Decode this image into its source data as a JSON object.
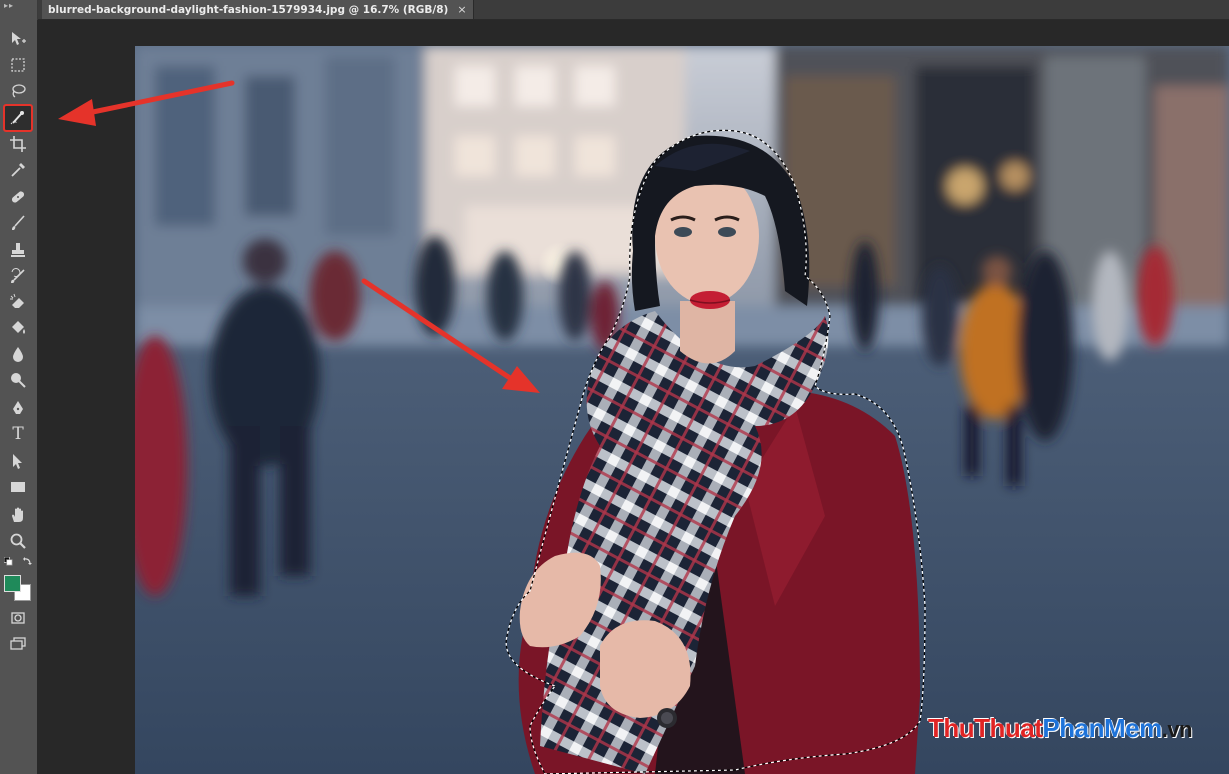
{
  "document_tab": {
    "title": "blurred-background-daylight-fashion-1579934.jpg @ 16.7% (RGB/8)",
    "close_glyph": "×"
  },
  "toolbar": {
    "grip": "▸▸",
    "tools": [
      {
        "name": "move-tool",
        "icon": "move-icon"
      },
      {
        "name": "marquee-tool",
        "icon": "marquee-icon"
      },
      {
        "name": "lasso-tool",
        "icon": "lasso-icon"
      },
      {
        "name": "quick-selection-tool",
        "icon": "quick-selection-icon",
        "active": true
      },
      {
        "name": "crop-tool",
        "icon": "crop-icon"
      },
      {
        "name": "eyedropper-tool",
        "icon": "eyedropper-icon"
      },
      {
        "name": "healing-brush-tool",
        "icon": "bandage-icon"
      },
      {
        "name": "brush-tool",
        "icon": "brush-icon"
      },
      {
        "name": "clone-stamp-tool",
        "icon": "stamp-icon"
      },
      {
        "name": "history-brush-tool",
        "icon": "history-brush-icon"
      },
      {
        "name": "eraser-tool",
        "icon": "eraser-icon"
      },
      {
        "name": "paint-bucket-tool",
        "icon": "bucket-icon"
      },
      {
        "name": "blur-tool",
        "icon": "drop-icon"
      },
      {
        "name": "dodge-tool",
        "icon": "dodge-icon"
      },
      {
        "name": "pen-tool",
        "icon": "pen-icon"
      },
      {
        "name": "type-tool",
        "icon": "type-icon",
        "glyph": "T"
      },
      {
        "name": "path-selection-tool",
        "icon": "arrow-icon"
      },
      {
        "name": "rectangle-tool",
        "icon": "rectangle-icon"
      },
      {
        "name": "hand-tool",
        "icon": "hand-icon"
      },
      {
        "name": "zoom-tool",
        "icon": "zoom-icon"
      }
    ],
    "colors": {
      "foreground": "#1f8a5a",
      "background": "#ffffff"
    }
  },
  "annotation_color": "#e5332a",
  "watermark": {
    "part1": "ThuThuat",
    "part2": "PhanMem",
    "part3": ".vn"
  }
}
